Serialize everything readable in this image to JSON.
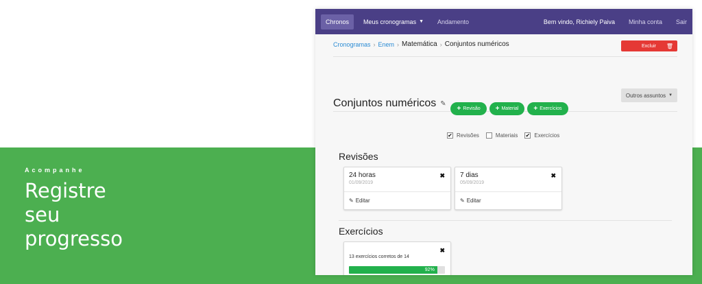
{
  "promo": {
    "eyebrow": "Acompanhe",
    "headline": [
      "Registre",
      "seu",
      "progresso"
    ]
  },
  "navbar": {
    "brand": "Chronos",
    "menu_label": "Meus cronogramas",
    "progress_link": "Andamento",
    "welcome": "Bem vindo, Richiely Paiva",
    "account": "Minha conta",
    "logout": "Sair"
  },
  "breadcrumb": {
    "items": [
      "Cronogramas",
      "Enem",
      "Matemática",
      "Conjuntos numéricos"
    ]
  },
  "actions": {
    "delete_label": "Excluir",
    "subjects_label": "Outros assuntos"
  },
  "page": {
    "title": "Conjuntos numéricos"
  },
  "add_buttons": [
    "Revisão",
    "Material",
    "Exercícios"
  ],
  "filters": [
    {
      "label": "Revisões",
      "checked": true
    },
    {
      "label": "Materiais",
      "checked": false
    },
    {
      "label": "Exercícios",
      "checked": true
    }
  ],
  "revisions": {
    "title": "Revisões",
    "cards": [
      {
        "title": "24 horas",
        "date": "01/09/2019",
        "edit_label": "Editar"
      },
      {
        "title": "7 dias",
        "date": "05/09/2019",
        "edit_label": "Editar"
      }
    ]
  },
  "exercises": {
    "title": "Exercícios",
    "cards": [
      {
        "text": "13 exercícios corretos de 14",
        "progress": 92,
        "progress_label": "92%"
      }
    ]
  },
  "colors": {
    "navbar": "#4a3f86",
    "green": "#22b14c",
    "danger": "#e53935",
    "band": "#4caf50"
  }
}
